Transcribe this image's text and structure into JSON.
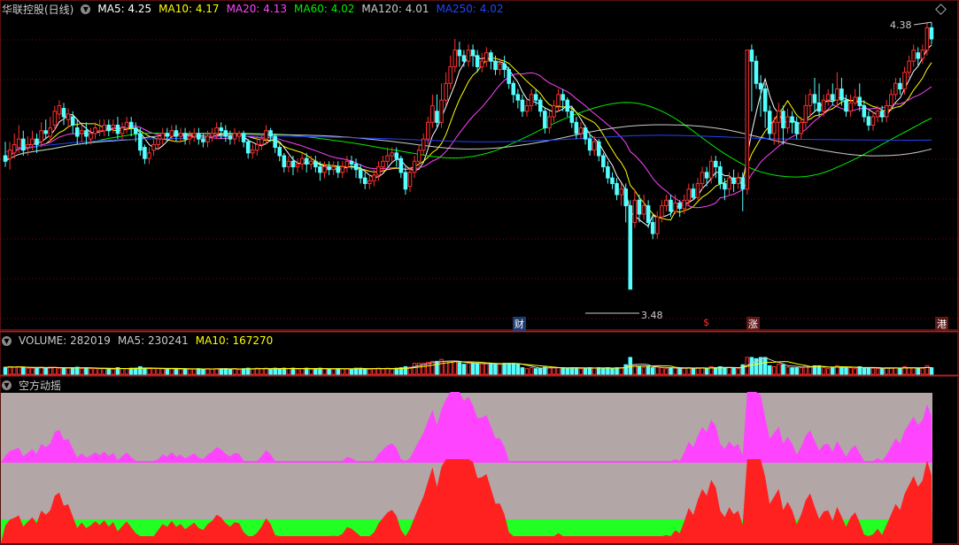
{
  "main": {
    "title": "华联控股(日线)",
    "ma_labels": [
      {
        "text": "MA5: 4.25",
        "color": "#ffffff"
      },
      {
        "text": "MA10: 4.17",
        "color": "#ffff00"
      },
      {
        "text": "MA20: 4.13",
        "color": "#ff44ff"
      },
      {
        "text": "MA60: 4.02",
        "color": "#00ee00"
      },
      {
        "text": "MA120: 4.01",
        "color": "#cccccc"
      },
      {
        "text": "MA250: 4.02",
        "color": "#2244ff"
      }
    ],
    "high_label": "4.38",
    "low_label": "3.48",
    "events": [
      {
        "text": "财",
        "color": "#ffffff",
        "bg": "#203a70",
        "index": 114
      },
      {
        "text": "$",
        "color": "#ff3030",
        "bg": "transparent",
        "index": 156
      },
      {
        "text": "涨",
        "color": "#ffffff",
        "bg": "#601818",
        "index": 166
      },
      {
        "text": "港",
        "color": "#ffffff",
        "bg": "#601818",
        "index": 208
      }
    ]
  },
  "volume": {
    "label": "VOLUME: 282019",
    "ma5": "MA5: 230241",
    "ma10": "MA10: 167270"
  },
  "indicator": {
    "title": "空方动摇"
  },
  "colors": {
    "up": "#ff3030",
    "down": "#54ffff",
    "grid": "#6b0f0f",
    "axis": "#b02020"
  },
  "chart_data": {
    "type": "candlestick",
    "ylim": [
      3.4,
      4.45
    ],
    "candles": [
      [
        3.96,
        3.94,
        4.01,
        3.92
      ],
      [
        3.95,
        3.98,
        4.01,
        3.91
      ],
      [
        3.97,
        4.0,
        4.04,
        3.95
      ],
      [
        3.99,
        4.02,
        4.07,
        3.97
      ],
      [
        4.02,
        3.98,
        4.05,
        3.96
      ],
      [
        3.99,
        4.0,
        4.03,
        3.96
      ],
      [
        4.0,
        4.02,
        4.05,
        3.98
      ],
      [
        4.02,
        4.0,
        4.04,
        3.97
      ],
      [
        4.01,
        4.05,
        4.08,
        3.99
      ],
      [
        4.05,
        4.04,
        4.09,
        4.02
      ],
      [
        4.03,
        4.06,
        4.1,
        4.01
      ],
      [
        4.07,
        4.12,
        4.14,
        4.05
      ],
      [
        4.11,
        4.14,
        4.16,
        4.09
      ],
      [
        4.13,
        4.1,
        4.15,
        4.07
      ],
      [
        4.09,
        4.11,
        4.13,
        4.06
      ],
      [
        4.1,
        4.07,
        4.12,
        4.04
      ],
      [
        4.06,
        4.03,
        4.09,
        4.0
      ],
      [
        4.04,
        4.05,
        4.07,
        4.01
      ],
      [
        4.05,
        4.03,
        4.08,
        4.0
      ],
      [
        4.02,
        4.04,
        4.06,
        4.0
      ],
      [
        4.04,
        4.06,
        4.08,
        4.02
      ],
      [
        4.05,
        4.05,
        4.09,
        4.03
      ],
      [
        4.05,
        4.07,
        4.09,
        4.03
      ],
      [
        4.07,
        4.05,
        4.09,
        4.03
      ],
      [
        4.06,
        4.07,
        4.09,
        4.04
      ],
      [
        4.07,
        4.04,
        4.1,
        4.02
      ],
      [
        4.04,
        4.06,
        4.08,
        4.02
      ],
      [
        4.06,
        4.08,
        4.1,
        4.04
      ],
      [
        4.08,
        4.06,
        4.1,
        4.03
      ],
      [
        4.06,
        4.04,
        4.08,
        4.01
      ],
      [
        4.04,
        3.98,
        4.06,
        3.96
      ],
      [
        3.99,
        3.95,
        4.0,
        3.93
      ],
      [
        3.95,
        3.97,
        3.99,
        3.93
      ],
      [
        3.98,
        4.0,
        4.02,
        3.96
      ],
      [
        4.0,
        4.02,
        4.04,
        3.98
      ],
      [
        4.02,
        4.04,
        4.06,
        4.0
      ],
      [
        4.04,
        4.03,
        4.06,
        4.01
      ],
      [
        4.03,
        4.05,
        4.07,
        4.01
      ],
      [
        4.05,
        4.03,
        4.07,
        4.01
      ],
      [
        4.03,
        4.04,
        4.06,
        4.01
      ],
      [
        4.04,
        4.02,
        4.06,
        4.0
      ],
      [
        4.02,
        4.03,
        4.05,
        4.0
      ],
      [
        4.03,
        4.04,
        4.06,
        4.01
      ],
      [
        4.04,
        4.02,
        4.06,
        4.0
      ],
      [
        4.02,
        4.01,
        4.04,
        3.99
      ],
      [
        4.01,
        4.03,
        4.05,
        3.99
      ],
      [
        4.03,
        4.04,
        4.06,
        4.01
      ],
      [
        4.04,
        4.06,
        4.08,
        4.02
      ],
      [
        4.06,
        4.05,
        4.08,
        4.02
      ],
      [
        4.05,
        4.03,
        4.07,
        4.01
      ],
      [
        4.03,
        4.02,
        4.05,
        4.0
      ],
      [
        4.02,
        4.04,
        4.06,
        4.0
      ],
      [
        4.03,
        4.04,
        4.05,
        4.01
      ],
      [
        4.04,
        4.01,
        4.05,
        3.99
      ],
      [
        4.01,
        3.97,
        4.02,
        3.95
      ],
      [
        3.97,
        3.98,
        4.0,
        3.95
      ],
      [
        3.98,
        4.0,
        4.03,
        3.96
      ],
      [
        4.0,
        4.02,
        4.04,
        3.98
      ],
      [
        4.02,
        4.05,
        4.07,
        4.0
      ],
      [
        4.05,
        4.03,
        4.06,
        4.01
      ],
      [
        4.03,
        3.99,
        4.04,
        3.97
      ],
      [
        3.99,
        3.96,
        4.0,
        3.94
      ],
      [
        3.96,
        3.92,
        3.97,
        3.9
      ],
      [
        3.92,
        3.94,
        3.96,
        3.9
      ],
      [
        3.94,
        3.92,
        3.96,
        3.89
      ],
      [
        3.92,
        3.93,
        3.95,
        3.9
      ],
      [
        3.93,
        3.95,
        3.97,
        3.91
      ],
      [
        3.95,
        3.93,
        3.97,
        3.9
      ],
      [
        3.93,
        3.94,
        3.96,
        3.91
      ],
      [
        3.94,
        3.92,
        3.96,
        3.9
      ],
      [
        3.92,
        3.9,
        3.94,
        3.87
      ],
      [
        3.9,
        3.92,
        3.94,
        3.88
      ],
      [
        3.92,
        3.91,
        3.94,
        3.89
      ],
      [
        3.91,
        3.92,
        3.94,
        3.89
      ],
      [
        3.92,
        3.9,
        3.94,
        3.88
      ],
      [
        3.9,
        3.92,
        3.94,
        3.88
      ],
      [
        3.92,
        3.94,
        3.96,
        3.9
      ],
      [
        3.94,
        3.93,
        3.96,
        3.91
      ],
      [
        3.93,
        3.91,
        3.95,
        3.88
      ],
      [
        3.91,
        3.88,
        3.93,
        3.86
      ],
      [
        3.88,
        3.86,
        3.9,
        3.84
      ],
      [
        3.86,
        3.87,
        3.89,
        3.84
      ],
      [
        3.87,
        3.89,
        3.91,
        3.85
      ],
      [
        3.89,
        3.92,
        3.94,
        3.87
      ],
      [
        3.92,
        3.94,
        3.96,
        3.9
      ],
      [
        3.94,
        3.96,
        3.99,
        3.92
      ],
      [
        3.96,
        3.97,
        3.99,
        3.94
      ],
      [
        3.97,
        3.95,
        3.99,
        3.92
      ],
      [
        3.95,
        3.9,
        3.96,
        3.88
      ],
      [
        3.9,
        3.84,
        3.92,
        3.82
      ],
      [
        3.85,
        3.9,
        3.92,
        3.83
      ],
      [
        3.9,
        3.94,
        3.96,
        3.88
      ],
      [
        3.94,
        3.98,
        4.0,
        3.92
      ],
      [
        3.98,
        4.02,
        4.04,
        3.96
      ],
      [
        4.02,
        4.08,
        4.1,
        4.0
      ],
      [
        4.08,
        4.14,
        4.18,
        4.06
      ],
      [
        4.12,
        4.08,
        4.18,
        4.06
      ],
      [
        4.08,
        4.16,
        4.22,
        4.06
      ],
      [
        4.16,
        4.22,
        4.26,
        4.14
      ],
      [
        4.22,
        4.28,
        4.32,
        4.2
      ],
      [
        4.28,
        4.34,
        4.38,
        4.26
      ],
      [
        4.34,
        4.32,
        4.37,
        4.28
      ],
      [
        4.32,
        4.3,
        4.34,
        4.28
      ],
      [
        4.3,
        4.34,
        4.36,
        4.28
      ],
      [
        4.34,
        4.32,
        4.36,
        4.28
      ],
      [
        4.32,
        4.28,
        4.34,
        4.26
      ],
      [
        4.28,
        4.3,
        4.33,
        4.26
      ],
      [
        4.3,
        4.33,
        4.35,
        4.28
      ],
      [
        4.33,
        4.3,
        4.34,
        4.27
      ],
      [
        4.3,
        4.27,
        4.32,
        4.25
      ],
      [
        4.27,
        4.29,
        4.31,
        4.25
      ],
      [
        4.29,
        4.27,
        4.32,
        4.24
      ],
      [
        4.27,
        4.22,
        4.28,
        4.2
      ],
      [
        4.22,
        4.18,
        4.23,
        4.15
      ],
      [
        4.18,
        4.16,
        4.2,
        4.13
      ],
      [
        4.16,
        4.12,
        4.18,
        4.1
      ],
      [
        4.12,
        4.14,
        4.16,
        4.1
      ],
      [
        4.14,
        4.18,
        4.2,
        4.12
      ],
      [
        4.18,
        4.16,
        4.2,
        4.14
      ],
      [
        4.16,
        4.12,
        4.17,
        4.1
      ],
      [
        4.12,
        4.06,
        4.13,
        4.04
      ],
      [
        4.06,
        4.1,
        4.12,
        4.04
      ],
      [
        4.1,
        4.14,
        4.16,
        4.08
      ],
      [
        4.14,
        4.18,
        4.2,
        4.12
      ],
      [
        4.18,
        4.16,
        4.2,
        4.12
      ],
      [
        4.16,
        4.12,
        4.17,
        4.1
      ],
      [
        4.12,
        4.08,
        4.14,
        4.06
      ],
      [
        4.08,
        4.04,
        4.1,
        4.02
      ],
      [
        4.04,
        4.06,
        4.08,
        4.02
      ],
      [
        4.06,
        4.02,
        4.07,
        4.0
      ],
      [
        4.02,
        3.98,
        4.04,
        3.96
      ],
      [
        3.98,
        4.01,
        4.03,
        3.96
      ],
      [
        4.01,
        3.96,
        4.02,
        3.94
      ],
      [
        3.96,
        3.92,
        3.97,
        3.9
      ],
      [
        3.92,
        3.88,
        3.94,
        3.86
      ],
      [
        3.88,
        3.86,
        3.9,
        3.84
      ],
      [
        3.86,
        3.82,
        3.88,
        3.8
      ],
      [
        3.82,
        3.84,
        3.86,
        3.78
      ],
      [
        3.84,
        3.78,
        3.86,
        3.72
      ],
      [
        3.78,
        3.48,
        3.8,
        3.48
      ],
      [
        3.72,
        3.8,
        3.84,
        3.7
      ],
      [
        3.8,
        3.75,
        3.82,
        3.72
      ],
      [
        3.75,
        3.78,
        3.82,
        3.73
      ],
      [
        3.78,
        3.72,
        3.8,
        3.7
      ],
      [
        3.72,
        3.68,
        3.74,
        3.66
      ],
      [
        3.68,
        3.74,
        3.76,
        3.66
      ],
      [
        3.74,
        3.78,
        3.8,
        3.72
      ],
      [
        3.78,
        3.8,
        3.82,
        3.76
      ],
      [
        3.8,
        3.76,
        3.82,
        3.74
      ],
      [
        3.76,
        3.79,
        3.82,
        3.75
      ],
      [
        3.79,
        3.77,
        3.8,
        3.74
      ],
      [
        3.77,
        3.8,
        3.82,
        3.75
      ],
      [
        3.8,
        3.84,
        3.86,
        3.78
      ],
      [
        3.84,
        3.81,
        3.86,
        3.8
      ],
      [
        3.81,
        3.86,
        3.88,
        3.8
      ],
      [
        3.86,
        3.9,
        3.92,
        3.84
      ],
      [
        3.9,
        3.88,
        3.92,
        3.85
      ],
      [
        3.88,
        3.94,
        3.96,
        3.86
      ],
      [
        3.94,
        3.92,
        3.96,
        3.88
      ],
      [
        3.92,
        3.86,
        3.94,
        3.84
      ],
      [
        3.86,
        3.84,
        3.88,
        3.8
      ],
      [
        3.84,
        3.88,
        3.9,
        3.82
      ],
      [
        3.88,
        3.86,
        3.91,
        3.83
      ],
      [
        3.86,
        3.88,
        3.9,
        3.84
      ],
      [
        3.88,
        3.84,
        3.9,
        3.76
      ],
      [
        3.84,
        4.34,
        4.34,
        3.82
      ],
      [
        4.34,
        4.3,
        4.36,
        4.12
      ],
      [
        4.3,
        4.22,
        4.32,
        4.2
      ],
      [
        4.22,
        4.2,
        4.25,
        4.1
      ],
      [
        4.2,
        4.12,
        4.22,
        4.06
      ],
      [
        4.12,
        4.04,
        4.14,
        4.02
      ],
      [
        4.04,
        4.08,
        4.1,
        4.0
      ],
      [
        4.08,
        4.12,
        4.15,
        4.0
      ],
      [
        4.12,
        4.06,
        4.14,
        4.0
      ],
      [
        4.06,
        4.1,
        4.13,
        4.04
      ],
      [
        4.1,
        4.08,
        4.12,
        4.04
      ],
      [
        4.08,
        4.04,
        4.1,
        4.02
      ],
      [
        4.04,
        4.08,
        4.1,
        4.02
      ],
      [
        4.08,
        4.14,
        4.18,
        4.06
      ],
      [
        4.14,
        4.18,
        4.2,
        4.1
      ],
      [
        4.18,
        4.15,
        4.24,
        4.12
      ],
      [
        4.15,
        4.12,
        4.22,
        4.1
      ],
      [
        4.12,
        4.16,
        4.18,
        4.1
      ],
      [
        4.16,
        4.18,
        4.2,
        4.14
      ],
      [
        4.18,
        4.16,
        4.22,
        4.14
      ],
      [
        4.16,
        4.2,
        4.26,
        4.14
      ],
      [
        4.2,
        4.16,
        4.24,
        4.14
      ],
      [
        4.16,
        4.12,
        4.18,
        4.1
      ],
      [
        4.12,
        4.15,
        4.18,
        4.1
      ],
      [
        4.15,
        4.17,
        4.2,
        4.14
      ],
      [
        4.17,
        4.14,
        4.22,
        4.12
      ],
      [
        4.14,
        4.1,
        4.16,
        4.08
      ],
      [
        4.1,
        4.07,
        4.12,
        4.05
      ],
      [
        4.07,
        4.1,
        4.12,
        4.05
      ],
      [
        4.1,
        4.12,
        4.14,
        4.08
      ],
      [
        4.12,
        4.1,
        4.14,
        4.08
      ],
      [
        4.1,
        4.14,
        4.16,
        4.08
      ],
      [
        4.14,
        4.18,
        4.2,
        4.12
      ],
      [
        4.18,
        4.22,
        4.24,
        4.16
      ],
      [
        4.22,
        4.2,
        4.24,
        4.18
      ],
      [
        4.2,
        4.26,
        4.28,
        4.18
      ],
      [
        4.26,
        4.3,
        4.32,
        4.24
      ],
      [
        4.3,
        4.34,
        4.36,
        4.28
      ],
      [
        4.33,
        4.31,
        4.35,
        4.28
      ],
      [
        4.31,
        4.34,
        4.36,
        4.29
      ],
      [
        4.34,
        4.42,
        4.44,
        4.32
      ],
      [
        4.42,
        4.38,
        4.44,
        4.36
      ]
    ]
  }
}
